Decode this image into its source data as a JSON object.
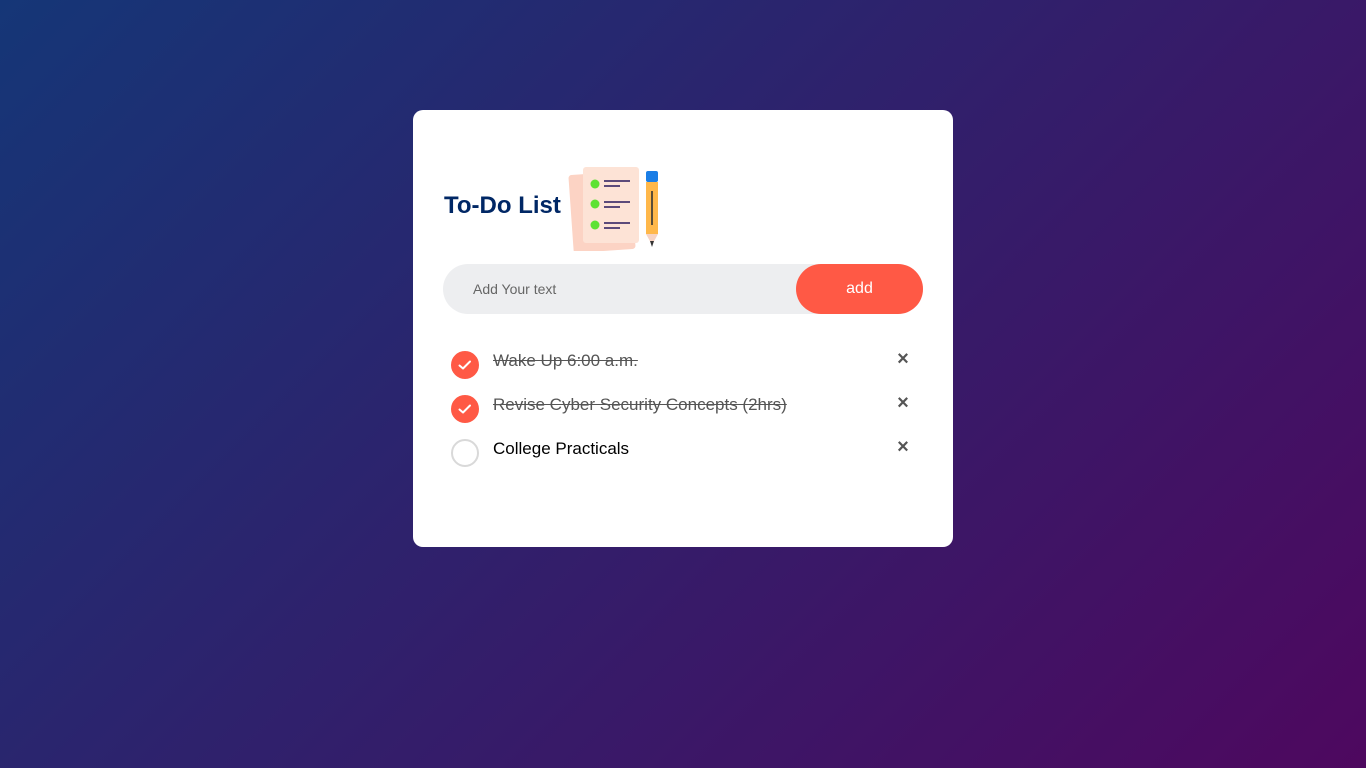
{
  "app": {
    "title": "To-Do List",
    "logo_icon": "todo-checklist-pencil-icon"
  },
  "input": {
    "placeholder": "Add Your text",
    "value": ""
  },
  "add_button": {
    "label": "add"
  },
  "tasks": [
    {
      "text": "Wake Up 6:00 a.m.",
      "checked": true,
      "remove_symbol": "×"
    },
    {
      "text": "Revise Cyber Security Concepts (2hrs)",
      "checked": true,
      "remove_symbol": "×"
    },
    {
      "text": "College Practicals",
      "checked": false,
      "remove_symbol": "×"
    }
  ],
  "colors": {
    "accent": "#ff5945",
    "title": "#002765",
    "input_bg": "#edeef0",
    "gradient_start": "#153677",
    "gradient_end": "#4e085f"
  }
}
